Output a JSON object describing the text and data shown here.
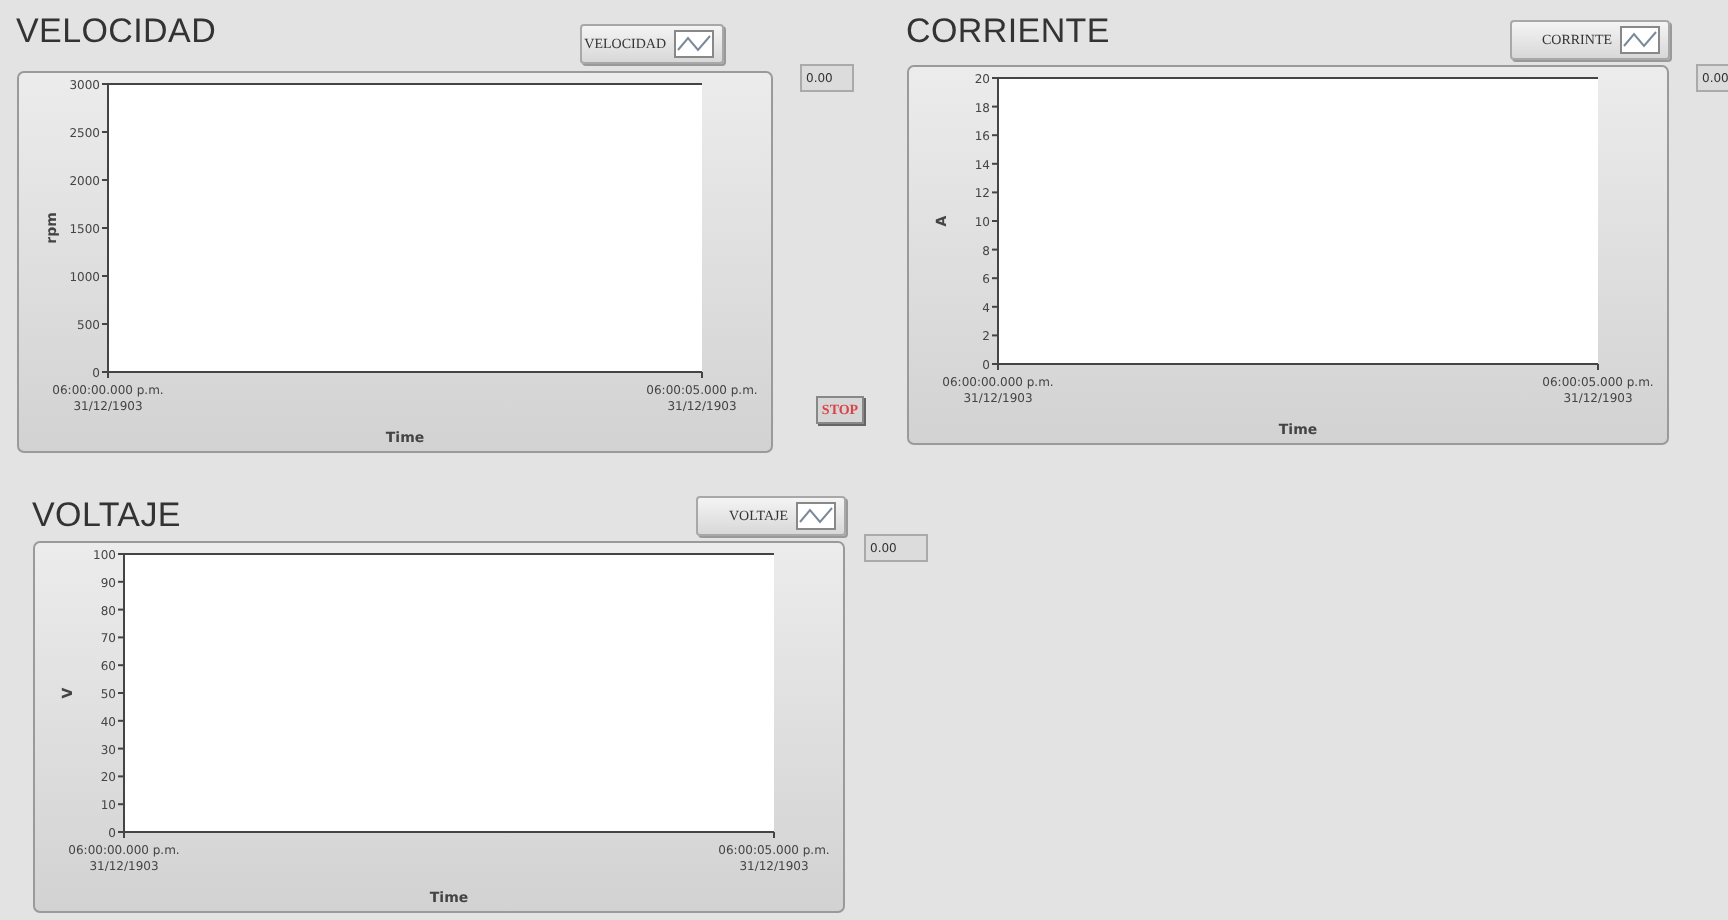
{
  "panels": [
    {
      "title": "VELOCIDAD",
      "legend": "VELOCIDAD",
      "indicator": "0.00",
      "chart_data": {
        "type": "line",
        "xlabel": "Time",
        "ylabel": "rpm",
        "ylim": [
          0,
          3000
        ],
        "yticks": [
          0,
          500,
          1000,
          1500,
          2000,
          2500,
          3000
        ],
        "categories": [
          "06:00:00.000 p.m.\n31/12/1903",
          "06:00:05.000 p.m.\n31/12/1903"
        ]
      }
    },
    {
      "title": "CORRIENTE",
      "legend": "CORRINTE",
      "indicator": "0.00",
      "chart_data": {
        "type": "line",
        "xlabel": "Time",
        "ylabel": "A",
        "ylim": [
          0,
          20
        ],
        "yticks": [
          0,
          2,
          4,
          6,
          8,
          10,
          12,
          14,
          16,
          18,
          20
        ],
        "categories": [
          "06:00:00.000 p.m.\n31/12/1903",
          "06:00:05.000 p.m.\n31/12/1903"
        ]
      }
    },
    {
      "title": "VOLTAJE",
      "legend": "VOLTAJE",
      "indicator": "0.00",
      "chart_data": {
        "type": "line",
        "xlabel": "Time",
        "ylabel": "V",
        "ylim": [
          0,
          100
        ],
        "yticks": [
          0,
          10,
          20,
          30,
          40,
          50,
          60,
          70,
          80,
          90,
          100
        ],
        "categories": [
          "06:00:00.000 p.m.\n31/12/1903",
          "06:00:05.000 p.m.\n31/12/1903"
        ]
      }
    }
  ],
  "stop_button": "STOP"
}
